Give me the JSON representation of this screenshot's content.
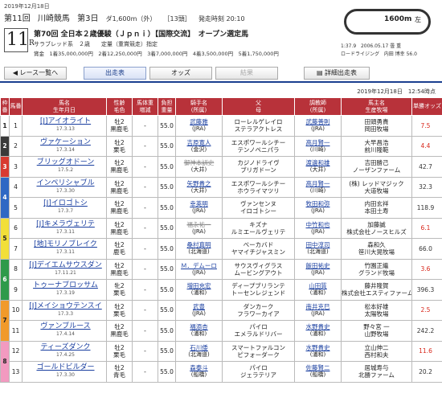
{
  "header": {
    "date": "2019年12月18日",
    "round": "第11回",
    "venue": "川崎競馬",
    "day": "第3日",
    "distance": "ダ1,600m（外）",
    "field": "［13頭］",
    "post_time": "発走時刻 20:10",
    "race_number": "11",
    "race_suffix": "R",
    "race_title": "第70回 全日本２歳優駿（Ｊｐｎｉ）【国際交流】　オープン選定馬",
    "conditions": "サラブレッド系　２歳　　定量（重賞競走）指定",
    "prizes": "賞金　1着35,000,000円　2着12,250,000円　3着7,000,000円　4着3,500,000円　5着1,750,000円",
    "course_length": "1600m",
    "course_dir": "左",
    "record_time": "1:37.9",
    "record_date": "2006.05.17",
    "record_weather": "曇",
    "record_going": "重",
    "record_horse": "ロードライジング",
    "record_jockey": "内田 博幸",
    "record_weight": "56.0"
  },
  "nav": {
    "back": "◀ レース一覧へ",
    "entries": "出走表",
    "odds": "オッズ",
    "result": "結果",
    "detail": "詳細出走表",
    "updated": "2019年12月18日　12:54時点"
  },
  "columns": [
    "枠番",
    "馬番",
    "馬名\n生年月日",
    "性齢\n毛色",
    "馬体重\n増減",
    "負担\n重量",
    "騎手名\n(所属)",
    "父\n母",
    "調教師\n(所属)",
    "馬主名\n生産牧場",
    "単勝オッズ"
  ],
  "rows": [
    {
      "waku": "1",
      "num": "1",
      "horse": "[J]アイオライト",
      "dob": "17.3.13",
      "sex": "牡2",
      "coat": "黒鹿毛",
      "weight": "-",
      "load": "55.0",
      "jockey": "武藤雅",
      "jaff": "(JRA)",
      "sire": "ローレルゲレイロ",
      "dam": "ステラアクトレス",
      "trainer": "武藤善則",
      "taff": "(JRA)",
      "owner": "田頭勇貴",
      "breeder": "岡田牧場",
      "odds": "7.5",
      "hot": true
    },
    {
      "waku": "2",
      "num": "2",
      "horse": "ヴァケーション",
      "dob": "17.3.14",
      "sex": "牡2",
      "coat": "栗毛",
      "weight": "-",
      "load": "55.0",
      "jockey": "吉原寛人",
      "jaff": "(金沢)",
      "sire": "エスポワールシチー",
      "dam": "テンノペニパラ",
      "trainer": "高月賢一",
      "taff": "(川崎)",
      "owner": "大早昌浩",
      "breeder": "前川隆範",
      "odds": "4.4",
      "hot": true
    },
    {
      "waku": "3",
      "num": "3",
      "horse": "ブリッグオドーン",
      "dob": "17.5.2",
      "sex": "牡2",
      "coat": "黒鹿毛",
      "weight": "-",
      "load": "55.0",
      "jockey": "御神本訓史",
      "jaff": "(大井)",
      "sire": "カジノドライヴ",
      "dam": "ブリガドーン",
      "trainer": "渡邊和雄",
      "taff": "(大井)",
      "owner": "吉田勝己",
      "breeder": "ノーザンファーム",
      "odds": "42.7",
      "hot": false,
      "jstrike": true
    },
    {
      "waku": "4",
      "num": "4",
      "horse": "インペリシャブル",
      "dob": "17.3.30",
      "sex": "牡2",
      "coat": "黒鹿毛",
      "weight": "-",
      "load": "55.0",
      "jockey": "矢野貴之",
      "jaff": "(大井)",
      "sire": "エスポワールシチー",
      "dam": "ホウライマツリ",
      "trainer": "高月賢一",
      "taff": "(川崎)",
      "owner": "(株) レッドマジック",
      "breeder": "大道牧場",
      "odds": "32.3",
      "hot": false
    },
    {
      "waku": "4",
      "num": "5",
      "horse": "[J]イロゴトシ",
      "dob": "17.3.7",
      "sex": "牡2",
      "coat": "黒鹿毛",
      "weight": "-",
      "load": "55.0",
      "jockey": "幸英明",
      "jaff": "(JRA)",
      "sire": "ヴァンセンヌ",
      "dam": "イロゴトシー",
      "trainer": "牧田和弥",
      "taff": "(JRA)",
      "owner": "内田玄祥",
      "breeder": "本田土寿",
      "odds": "118.9",
      "hot": false
    },
    {
      "waku": "5",
      "num": "6",
      "horse": "[J]キメラヴェリテ",
      "dob": "17.3.11",
      "sex": "牡2",
      "coat": "黒鹿毛",
      "weight": "-",
      "load": "55.0",
      "jockey": "福永祐一",
      "jaff": "(JRA)",
      "sire": "キズナ",
      "dam": "ルミエールヴェリテ",
      "trainer": "中竹和也",
      "taff": "(JRA)",
      "owner": "加藤誠",
      "breeder": "株式会社ノースヒルズ",
      "odds": "6.1",
      "hot": true,
      "jstrike": true
    },
    {
      "waku": "5",
      "num": "7",
      "horse": "[地]モリノブレイク",
      "dob": "17.3.11",
      "sex": "牡2",
      "coat": "鹿毛",
      "weight": "-",
      "load": "55.0",
      "jockey": "桑村真明",
      "jaff": "(北海道)",
      "sire": "ベーカバド",
      "dam": "ヤマイチジャスミン",
      "trainer": "田中淳司",
      "taff": "(北海道)",
      "owner": "森和久",
      "breeder": "笹川大晃牧場",
      "odds": "66.0",
      "hot": false
    },
    {
      "waku": "6",
      "num": "8",
      "horse": "[J]デイエムサウスダン",
      "dob": "17.11.21",
      "sex": "牡2",
      "coat": "黒鹿毛",
      "weight": "-",
      "load": "55.0",
      "jockey": "Ｍ．デムーロ",
      "jaff": "(JRA)",
      "sire": "サウスヴィグラス",
      "dam": "ムービングアウト",
      "trainer": "飯田祐史",
      "taff": "(JRA)",
      "owner": "竹園正繼",
      "breeder": "グランド牧場",
      "odds": "3.6",
      "hot": true
    },
    {
      "waku": "6",
      "num": "9",
      "horse": "トゥーナブロッサム",
      "dob": "17.3.19",
      "sex": "牝2",
      "coat": "栗毛",
      "weight": "-",
      "load": "55.0",
      "jockey": "増田充宏",
      "jaff": "(浦和)",
      "sire": "ディープブリランテ",
      "dam": "トーセンレジェンド",
      "trainer": "山田質",
      "taff": "(浦和)",
      "owner": "藤井隆賀",
      "breeder": "株式会社エスティファーム",
      "odds": "396.3",
      "hot": false
    },
    {
      "waku": "7",
      "num": "10",
      "horse": "[J]メイショウテンスイ",
      "dob": "17.3.3",
      "sex": "牡2",
      "coat": "栗毛",
      "weight": "-",
      "load": "55.0",
      "jockey": "武豊",
      "jaff": "(JRA)",
      "sire": "ダンカーク",
      "dam": "フラワーカイア",
      "trainer": "南井克巳",
      "taff": "(JRA)",
      "owner": "松本好雄",
      "breeder": "太陽牧場",
      "odds": "2.5",
      "hot": true
    },
    {
      "waku": "7",
      "num": "11",
      "horse": "ヴァンブルース",
      "dob": "17.4.14",
      "sex": "牡2",
      "coat": "黒鹿毛",
      "weight": "-",
      "load": "55.0",
      "jockey": "福添杏",
      "jaff": "(浦和)",
      "sire": "パイロ",
      "dam": "エメラルドリバー",
      "trainer": "水野貴史",
      "taff": "(浦和)",
      "owner": "野々宮 一",
      "breeder": "山野牧場",
      "odds": "242.2",
      "hot": false
    },
    {
      "waku": "8",
      "num": "12",
      "horse": "ティーズダンク",
      "dob": "17.4.25",
      "sex": "牡2",
      "coat": "栗毛",
      "weight": "-",
      "load": "55.0",
      "jockey": "石川倭",
      "jaff": "(北海道)",
      "sire": "スマートファルコン",
      "dam": "ピフォーダーク",
      "trainer": "水野貴史",
      "taff": "(浦和)",
      "owner": "立山伸二",
      "breeder": "西村和夫",
      "odds": "11.6",
      "hot": true
    },
    {
      "waku": "8",
      "num": "13",
      "horse": "ゴールドビルダー",
      "dob": "17.3.30",
      "sex": "牡2",
      "coat": "青毛",
      "weight": "-",
      "load": "55.0",
      "jockey": "森泰斗",
      "jaff": "(船橋)",
      "sire": "パイロ",
      "dam": "ジェラテリア",
      "trainer": "佐藤賢二",
      "taff": "(船橋)",
      "owner": "居城寿与",
      "breeder": "北勝ファーム",
      "odds": "20.2",
      "hot": false
    }
  ],
  "waku_colors": {
    "1": "#ffffff",
    "2": "#3a3a3a",
    "3": "#d83a30",
    "4": "#2f68c4",
    "5": "#f2df39",
    "6": "#2e9a4a",
    "7": "#f19a2b",
    "8": "#f29ac0"
  },
  "waku_text": {
    "1": "#222222",
    "2": "#ffffff",
    "3": "#ffffff",
    "4": "#ffffff",
    "5": "#222222",
    "6": "#ffffff",
    "7": "#222222",
    "8": "#222222"
  }
}
